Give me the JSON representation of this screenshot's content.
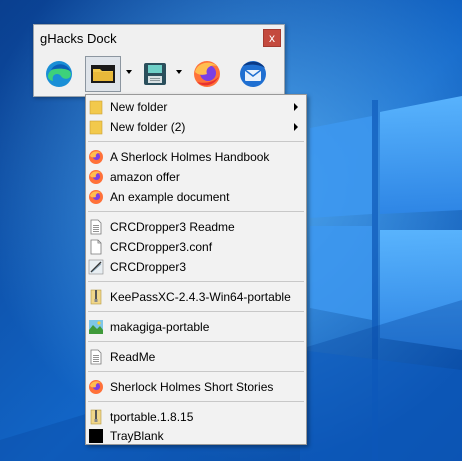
{
  "dock": {
    "title": "gHacks Dock",
    "close_label": "x",
    "apps": [
      {
        "name": "edge-icon",
        "state": "normal"
      },
      {
        "name": "folder-icon",
        "state": "pressed",
        "has_dropdown": true
      },
      {
        "name": "floppy-disk-icon",
        "state": "normal",
        "has_dropdown": true
      },
      {
        "name": "firefox-icon",
        "state": "normal"
      },
      {
        "name": "thunderbird-icon",
        "state": "normal"
      }
    ]
  },
  "menu": {
    "items": [
      {
        "label": "New folder",
        "icon": "folder-icon",
        "submenu": true
      },
      {
        "label": "New folder (2)",
        "icon": "folder-icon",
        "submenu": true
      },
      {
        "label": "A Sherlock Holmes Handbook",
        "icon": "firefox-icon"
      },
      {
        "label": "amazon offer",
        "icon": "firefox-icon"
      },
      {
        "label": "An example document",
        "icon": "firefox-icon"
      },
      {
        "label": "CRCDropper3 Readme",
        "icon": "text-file-icon"
      },
      {
        "label": "CRCDropper3.conf",
        "icon": "blank-file-icon"
      },
      {
        "label": "CRCDropper3",
        "icon": "app-shortcut-icon"
      },
      {
        "label": "KeePassXC-2.4.3-Win64-portable",
        "icon": "archive-icon"
      },
      {
        "label": "makagiga-portable",
        "icon": "image-file-icon"
      },
      {
        "label": "ReadMe",
        "icon": "text-file-icon"
      },
      {
        "label": "Sherlock Holmes Short Stories",
        "icon": "firefox-icon"
      },
      {
        "label": "tportable.1.8.15",
        "icon": "archive-icon"
      },
      {
        "label": "TrayBlank",
        "icon": "black-square-icon"
      }
    ]
  },
  "colors": {
    "wallpaper_dark": "#0a4fa8",
    "wallpaper_light": "#4ca6f0",
    "folder_yellow": "#f2c94c",
    "firefox_orange": "#ff7139",
    "close_red": "#c44a3e"
  }
}
